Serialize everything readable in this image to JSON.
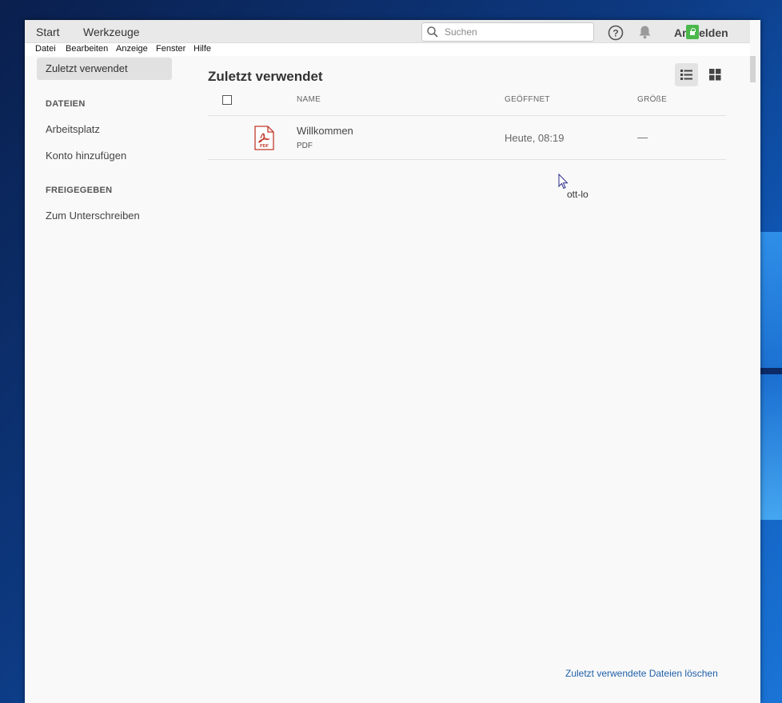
{
  "topbar": {
    "nav": [
      "Start",
      "Werkzeuge"
    ],
    "search_placeholder": "Suchen",
    "signin_label": "Anmelden"
  },
  "menubar": [
    "Datei",
    "Bearbeiten",
    "Anzeige",
    "Fenster",
    "Hilfe"
  ],
  "sidebar": {
    "recent": "Zuletzt verwendet",
    "files_heading": "DATEIEN",
    "files_items": [
      "Arbeitsplatz",
      "Konto hinzufügen"
    ],
    "shared_heading": "FREIGEGEBEN",
    "shared_items": [
      "Zum Unterschreiben"
    ]
  },
  "main": {
    "title": "Zuletzt verwendet",
    "columns": {
      "name": "NAME",
      "opened": "GEÖFFNET",
      "size": "GRÖßE"
    },
    "files": [
      {
        "name": "Willkommen",
        "type": "PDF",
        "opened": "Heute, 08:19",
        "size": "—"
      }
    ],
    "tooltip": "ott-lo",
    "clear_link": "Zuletzt verwendete Dateien löschen"
  },
  "colors": {
    "accent_link": "#1f5fa8",
    "pdf_red": "#c0392b",
    "lock_green": "#4ab84a"
  },
  "icons": [
    "search-icon",
    "help-icon",
    "bell-icon",
    "lock-icon",
    "list-view-icon",
    "grid-view-icon",
    "pdf-file-icon",
    "mouse-cursor"
  ]
}
